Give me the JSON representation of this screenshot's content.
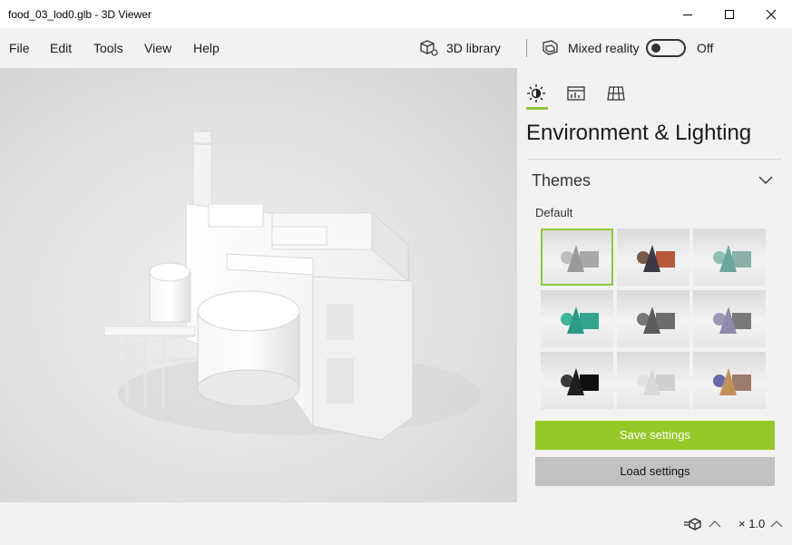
{
  "window": {
    "title": "food_03_lod0.glb - 3D Viewer"
  },
  "menu": {
    "items": [
      "File",
      "Edit",
      "Tools",
      "View",
      "Help"
    ]
  },
  "toolbar": {
    "library_label": "3D library",
    "mixed_reality_label": "Mixed reality",
    "toggle_state_label": "Off",
    "toggle_on": false
  },
  "panel": {
    "tabs": [
      "lighting-icon",
      "stats-icon",
      "grid-icon"
    ],
    "title": "Environment & Lighting",
    "themes_label": "Themes",
    "default_label": "Default",
    "themes": [
      {
        "id": "default",
        "selected": true,
        "cone": "#9a9a9a",
        "sphere": "#bdbdbd",
        "cube": "#a8a8a8"
      },
      {
        "id": "warm",
        "selected": false,
        "cone": "#3a3a44",
        "sphere": "#7a5a4a",
        "cube": "#b5593a"
      },
      {
        "id": "teal-soft",
        "selected": false,
        "cone": "#6aa89c",
        "sphere": "#8fbfb3",
        "cube": "#8ab0a8"
      },
      {
        "id": "teal",
        "selected": false,
        "cone": "#2c9a86",
        "sphere": "#3fb59c",
        "cube": "#34a48e"
      },
      {
        "id": "gray",
        "selected": false,
        "cone": "#5c5c5c",
        "sphere": "#777777",
        "cube": "#6c6c6c"
      },
      {
        "id": "violet",
        "selected": false,
        "cone": "#8e8aac",
        "sphere": "#9c99b4",
        "cube": "#7a7a7a"
      },
      {
        "id": "dark",
        "selected": false,
        "cone": "#1e1e1e",
        "sphere": "#3a3a3a",
        "cube": "#0f0f0f"
      },
      {
        "id": "light",
        "selected": false,
        "cone": "#d8d8d8",
        "sphere": "#e2e2e2",
        "cube": "#cfcfcf"
      },
      {
        "id": "sunset",
        "selected": false,
        "cone": "#c0925a",
        "sphere": "#6a6aa8",
        "cube": "#9c7a6c"
      }
    ],
    "save_label": "Save settings",
    "load_label": "Load settings"
  },
  "status": {
    "zoom_label": "× 1.0"
  },
  "colors": {
    "accent": "#96c928",
    "panel_bg": "#f2f2f2"
  }
}
